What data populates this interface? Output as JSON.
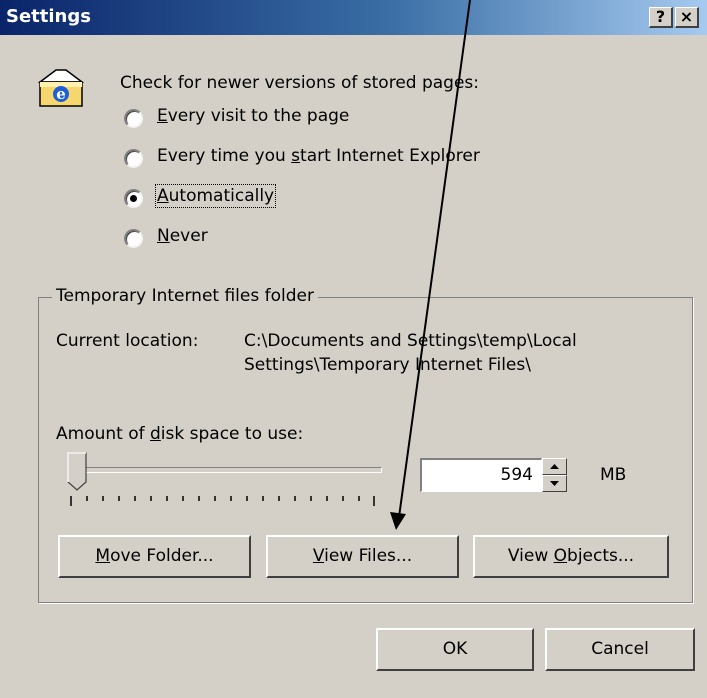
{
  "window": {
    "title": "Settings",
    "help_button": "?",
    "close_button": "×"
  },
  "check_section": {
    "heading": "Check for newer versions of stored pages:",
    "options": [
      {
        "label": "Every visit to the page",
        "selected": false
      },
      {
        "label": "Every time you start Internet Explorer",
        "selected": false
      },
      {
        "label": "Automatically",
        "selected": true
      },
      {
        "label": "Never",
        "selected": false
      }
    ]
  },
  "temp_folder": {
    "group_title": "Temporary Internet files folder",
    "current_location_label": "Current location:",
    "current_location_value_line1": "C:\\Documents and Settings\\temp\\Local",
    "current_location_value_line2": "Settings\\Temporary Internet Files\\",
    "disk_space_label": "Amount of disk space to use:",
    "disk_space_value": "594",
    "disk_space_unit": "MB",
    "slider_level": 0.04,
    "buttons": {
      "move_folder": "Move Folder...",
      "view_files": "View Files...",
      "view_objects": "View Objects..."
    }
  },
  "footer": {
    "ok": "OK",
    "cancel": "Cancel"
  },
  "icons": {
    "app_icon": "ie-folder-icon"
  },
  "colors": {
    "title_start": "#0a246a",
    "title_end": "#a6caf0",
    "face": "#d4d0c8"
  }
}
